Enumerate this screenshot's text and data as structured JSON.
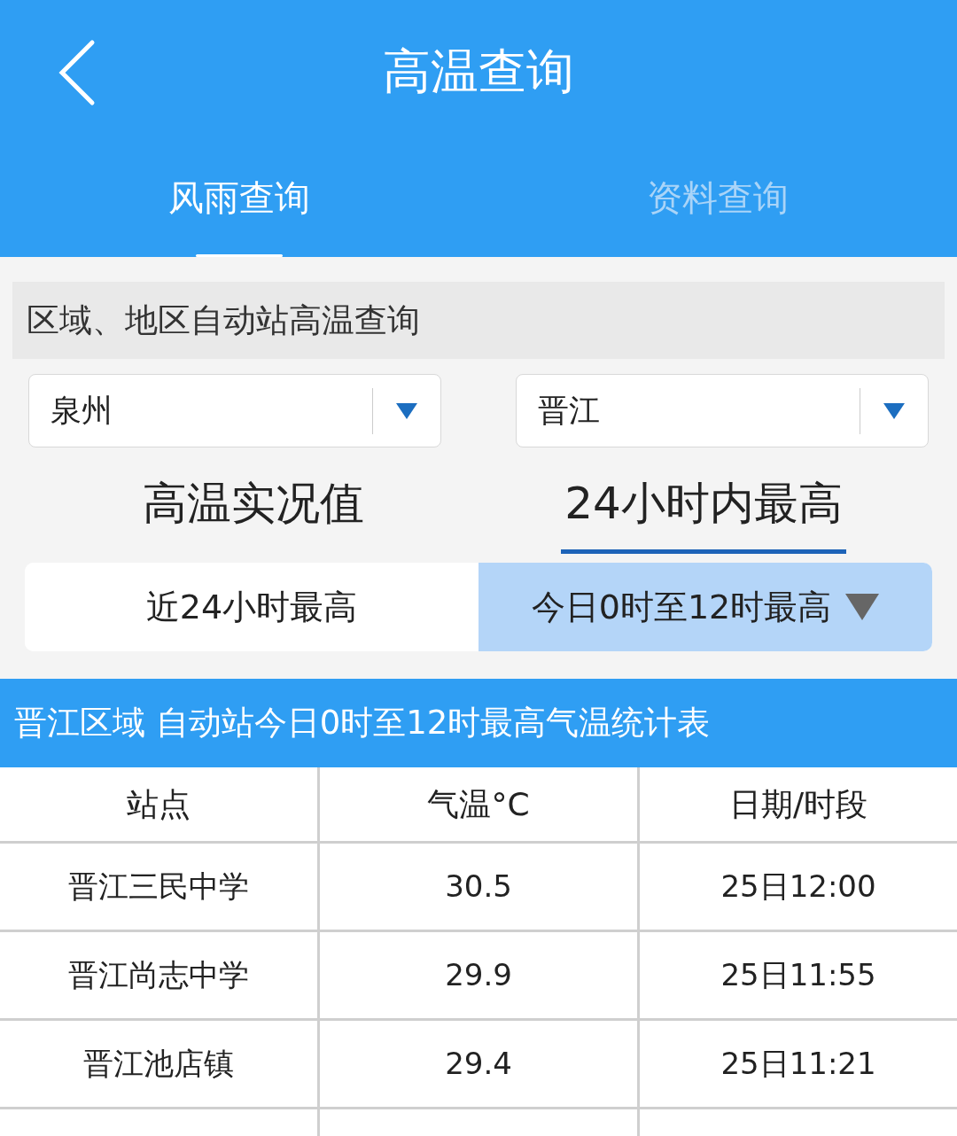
{
  "header": {
    "title": "高温查询"
  },
  "tabs": [
    {
      "label": "风雨查询",
      "selected": true
    },
    {
      "label": "资料查询",
      "selected": false
    }
  ],
  "section_title": "区域、地区自动站高温查询",
  "dropdowns": [
    {
      "value": "泉州"
    },
    {
      "value": "晋江"
    }
  ],
  "view_tabs": [
    {
      "label": "高温实况值",
      "selected": false
    },
    {
      "label": "24小时内最高",
      "selected": true
    }
  ],
  "period_options": [
    {
      "label": "近24小时最高",
      "selected": false
    },
    {
      "label": "今日0时至12时最高",
      "selected": true
    }
  ],
  "table": {
    "title": "晋江区域 自动站今日0时至12时最高气温统计表",
    "columns": [
      "站点",
      "气温°C",
      "日期/时段"
    ],
    "rows": [
      [
        "晋江三民中学",
        "30.5",
        "25日12:00"
      ],
      [
        "晋江尚志中学",
        "29.9",
        "25日11:55"
      ],
      [
        "晋江池店镇",
        "29.4",
        "25日11:21"
      ]
    ]
  }
}
